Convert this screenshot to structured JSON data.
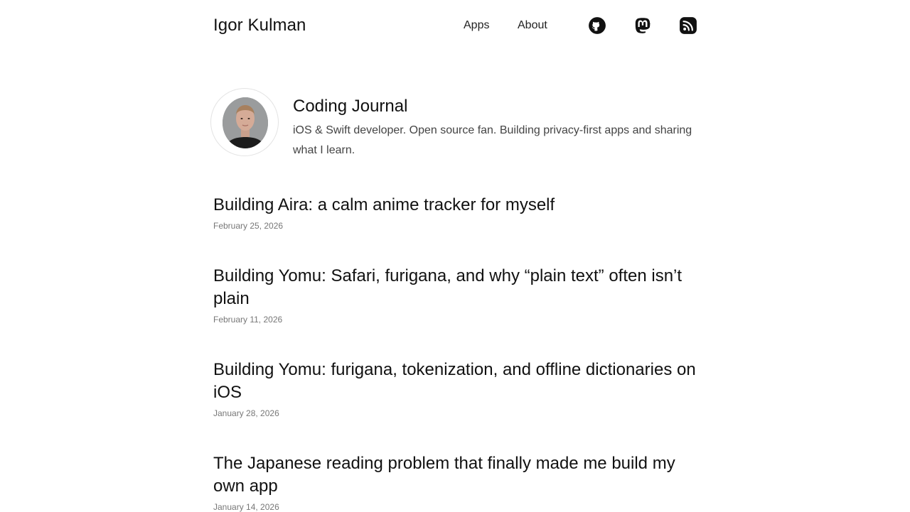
{
  "header": {
    "site_title": "Igor Kulman",
    "nav": [
      {
        "label": "Apps"
      },
      {
        "label": "About"
      }
    ],
    "social_icons": [
      "github-icon",
      "mastodon-icon",
      "rss-icon"
    ]
  },
  "profile": {
    "title": "Coding Journal",
    "bio": "iOS & Swift developer. Open source fan. Building privacy-first apps and sharing what I learn."
  },
  "posts": [
    {
      "title": "Building Aira: a calm anime tracker for myself",
      "date": "February 25, 2026"
    },
    {
      "title": "Building Yomu: Safari, furigana, and why “plain text” often isn’t plain",
      "date": "February 11, 2026"
    },
    {
      "title": "Building Yomu: furigana, tokenization, and offline dictionaries on iOS",
      "date": "January 28, 2026"
    },
    {
      "title": "The Japanese reading problem that finally made me build my own app",
      "date": "January 14, 2026"
    }
  ],
  "colors": {
    "text": "#111111",
    "muted": "#444444",
    "date": "#777777",
    "background": "#ffffff"
  }
}
